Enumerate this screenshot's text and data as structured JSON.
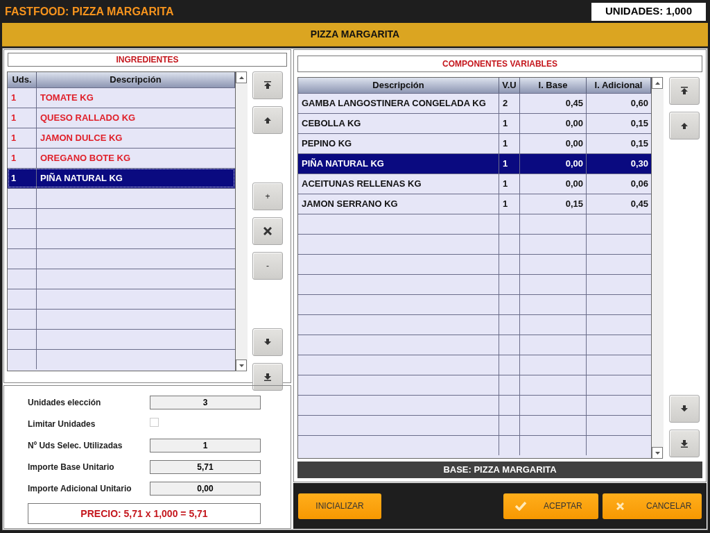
{
  "window": {
    "title": "FASTFOOD: PIZZA MARGARITA",
    "units": "UNIDADES: 1,000"
  },
  "header": {
    "title": "PIZZA MARGARITA"
  },
  "ingredients": {
    "title": "INGREDIENTES",
    "columns": [
      "Uds.",
      "Descripción"
    ],
    "rows": [
      {
        "qty": "1",
        "description": "TOMATE KG",
        "selected": false
      },
      {
        "qty": "1",
        "description": "QUESO RALLADO KG",
        "selected": false
      },
      {
        "qty": "1",
        "description": "JAMON DULCE KG",
        "selected": false
      },
      {
        "qty": "1",
        "description": "OREGANO BOTE KG",
        "selected": false
      },
      {
        "qty": "1",
        "description": "PIÑA NATURAL KG",
        "selected": true
      }
    ],
    "buttons": [
      {
        "kind": "top"
      },
      {
        "kind": "up"
      },
      {
        "kind": "gap"
      },
      {
        "kind": "text",
        "label": "+"
      },
      {
        "kind": "delete"
      },
      {
        "kind": "text",
        "label": "-"
      },
      {
        "kind": "gap"
      },
      {
        "kind": "down"
      },
      {
        "kind": "bottom"
      }
    ]
  },
  "summary": {
    "fields": [
      {
        "kind": "value",
        "label": "Unidades elección",
        "value": "3"
      },
      {
        "kind": "checkbox",
        "label": "Limitar Unidades",
        "checked": false
      },
      {
        "kind": "value",
        "label": "Nº Uds Selec. Utilizadas",
        "value": "1"
      },
      {
        "kind": "value",
        "label": "Importe Base Unitario",
        "value": "5,71"
      },
      {
        "kind": "value",
        "label": "Importe Adicional Unitario",
        "value": "0,00"
      }
    ],
    "price": "PRECIO: 5,71 x 1,000 = 5,71"
  },
  "components": {
    "title": "COMPONENTES VARIABLES",
    "columns": [
      "Descripción",
      "V.U",
      "I. Base",
      "I. Adicional"
    ],
    "rows": [
      {
        "description": "GAMBA LANGOSTINERA CONGELADA KG",
        "vu": "2",
        "base": "0,45",
        "extra": "0,60",
        "selected": false
      },
      {
        "description": "CEBOLLA KG",
        "vu": "1",
        "base": "0,00",
        "extra": "0,15",
        "selected": false
      },
      {
        "description": "PEPINO KG",
        "vu": "1",
        "base": "0,00",
        "extra": "0,15",
        "selected": false
      },
      {
        "description": "PIÑA NATURAL KG",
        "vu": "1",
        "base": "0,00",
        "extra": "0,30",
        "selected": true
      },
      {
        "description": "ACEITUNAS RELLENAS KG",
        "vu": "1",
        "base": "0,00",
        "extra": "0,06",
        "selected": false
      },
      {
        "description": "JAMON SERRANO KG",
        "vu": "1",
        "base": "0,15",
        "extra": "0,45",
        "selected": false
      }
    ],
    "base_label": "BASE: PIZZA MARGARITA"
  },
  "actions": [
    {
      "kind": "plain",
      "label": "INICIALIZAR"
    },
    {
      "kind": "accept",
      "label": "ACEPTAR"
    },
    {
      "kind": "cancel",
      "label": "CANCELAR"
    }
  ]
}
